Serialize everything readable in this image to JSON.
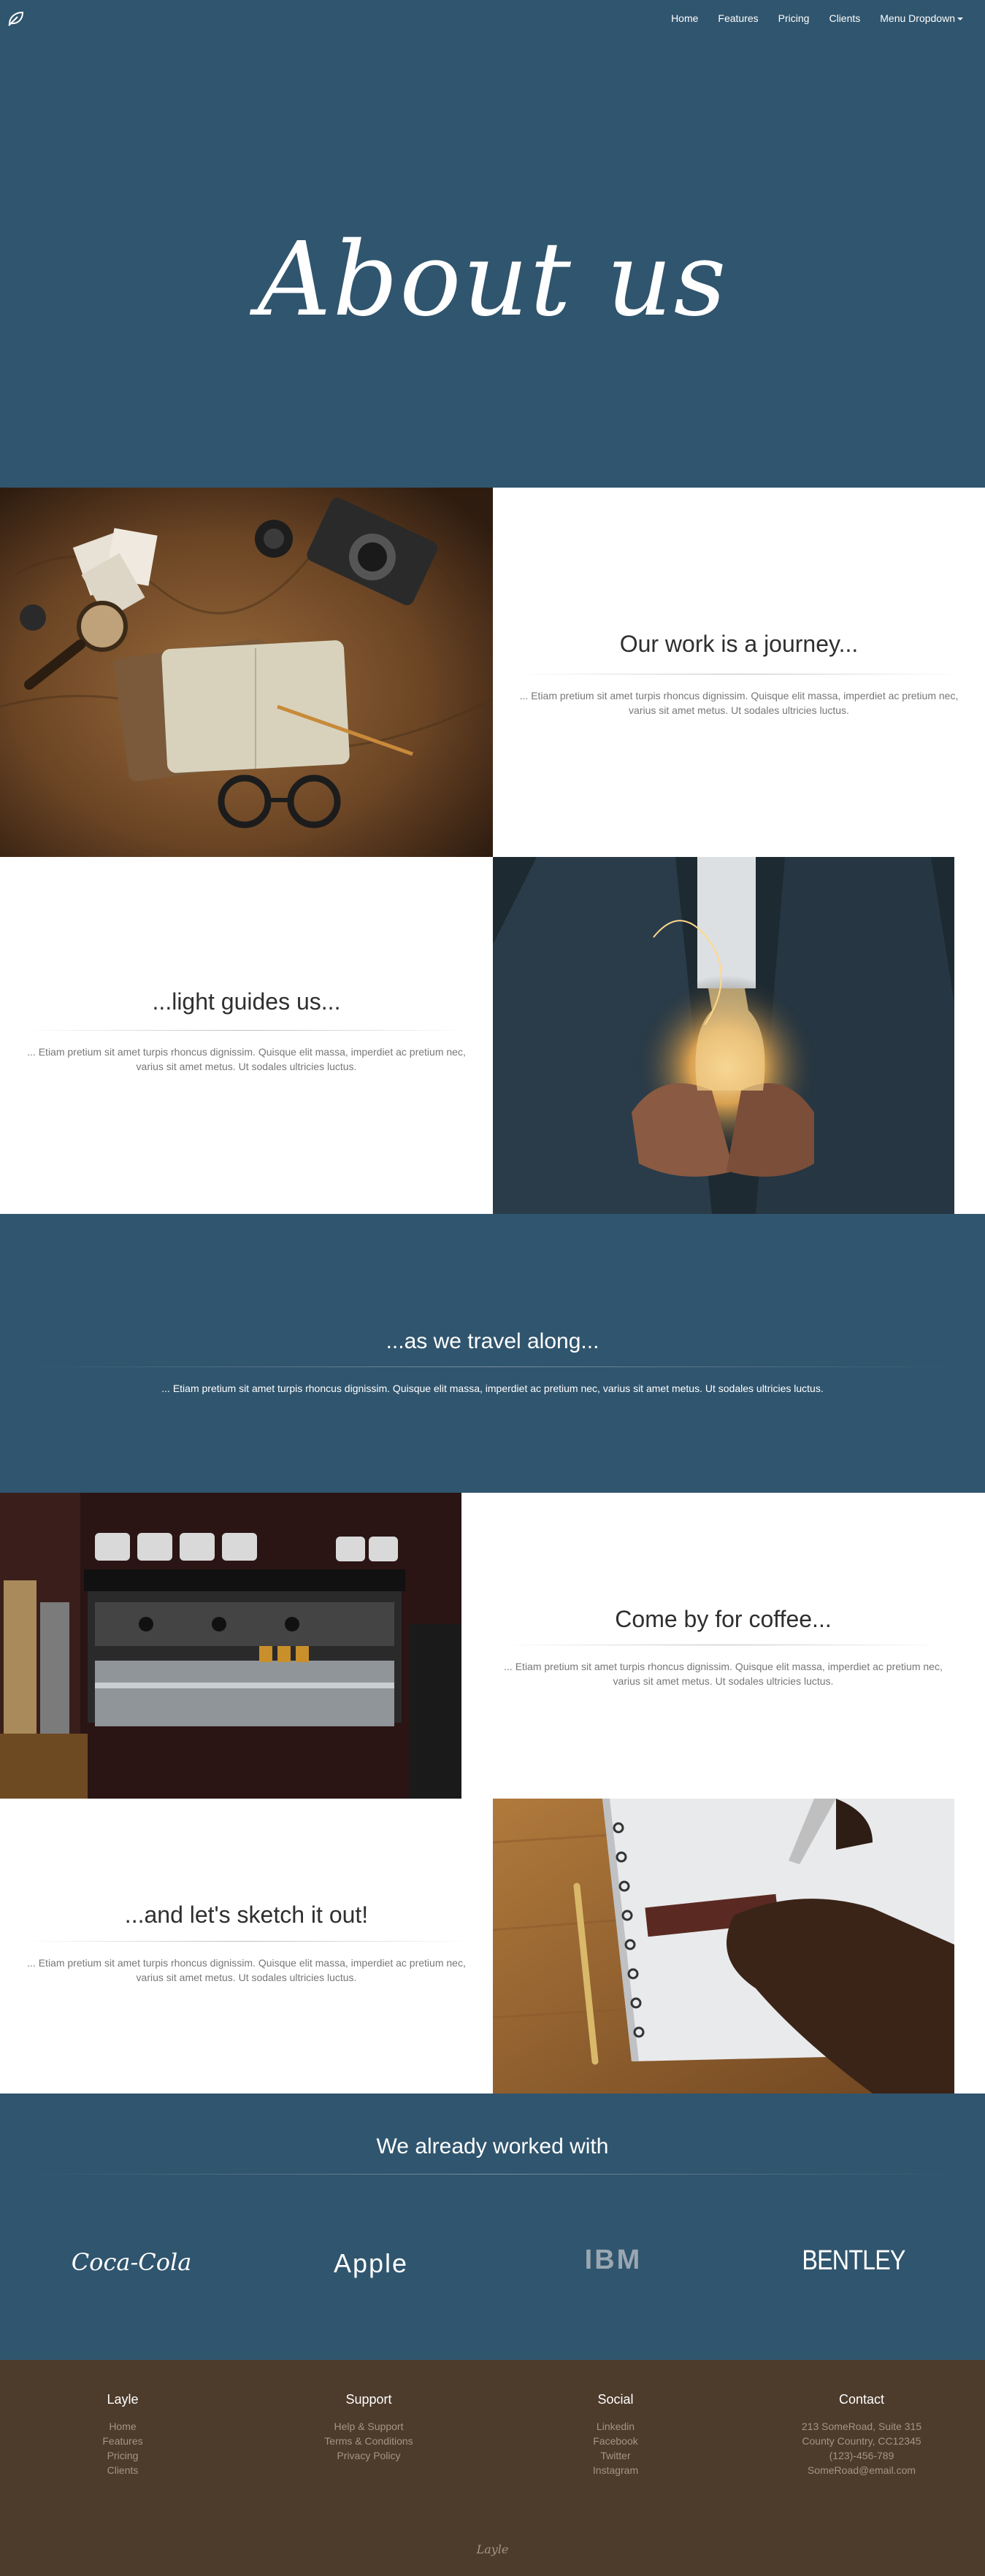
{
  "nav": {
    "logo_icon": "leaf-icon",
    "items": [
      "Home",
      "Features",
      "Pricing",
      "Clients",
      "Menu Dropdown"
    ]
  },
  "hero": {
    "title": "About us"
  },
  "sections": [
    {
      "title": "Our work is a journey...",
      "text": "... Etiam pretium sit amet turpis rhoncus dignissim. Quisque elit massa, imperdiet ac pretium nec, varius sit amet metus. Ut sodales ultricies luctus."
    },
    {
      "title": "...light guides us...",
      "text": "... Etiam pretium sit amet turpis rhoncus dignissim. Quisque elit massa, imperdiet ac pretium nec, varius sit amet metus. Ut sodales ultricies luctus."
    },
    {
      "title": "...as we travel along...",
      "text": "... Etiam pretium sit amet turpis rhoncus dignissim. Quisque elit massa, imperdiet ac pretium nec, varius sit amet metus. Ut sodales ultricies luctus."
    },
    {
      "title": "Come by for coffee...",
      "text": "... Etiam pretium sit amet turpis rhoncus dignissim. Quisque elit massa, imperdiet ac pretium nec, varius sit amet metus. Ut sodales ultricies luctus."
    },
    {
      "title": "...and let's sketch it out!",
      "text": "... Etiam pretium sit amet turpis rhoncus dignissim. Quisque elit massa, imperdiet ac pretium nec, varius sit amet metus. Ut sodales ultricies luctus."
    }
  ],
  "clients": {
    "title": "We already worked with",
    "logos": [
      "Coca-Cola",
      "Apple",
      "IBM",
      "BENTLEY"
    ]
  },
  "footer": {
    "columns": [
      {
        "title": "Layle",
        "links": [
          "Home",
          "Features",
          "Pricing",
          "Clients"
        ]
      },
      {
        "title": "Support",
        "links": [
          "Help & Support",
          "Terms & Conditions",
          "Privacy Policy"
        ]
      },
      {
        "title": "Social",
        "links": [
          "Linkedin",
          "Facebook",
          "Twitter",
          "Instagram"
        ]
      },
      {
        "title": "Contact",
        "links": [
          "213 SomeRoad, Suite 315",
          "County Country, CC12345",
          "(123)-456-789",
          "SomeRoad@email.com"
        ]
      }
    ],
    "brand": "Layle"
  },
  "colors": {
    "primary": "#30556e",
    "footer": "#4d3b2b",
    "footer_link": "#a39684"
  }
}
